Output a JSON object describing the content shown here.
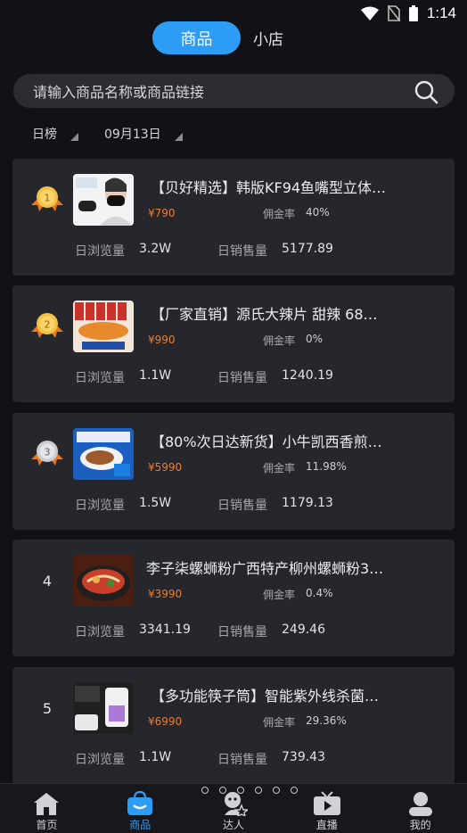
{
  "status_bar": {
    "time": "1:14"
  },
  "top_tabs": {
    "active": "商品",
    "other": "小店"
  },
  "search": {
    "placeholder": "请输入商品名称或商品链接"
  },
  "filters": {
    "period": "日榜",
    "date": "09月13日"
  },
  "list_labels": {
    "rate": "佣金率",
    "views": "日浏览量",
    "sales": "日销售量"
  },
  "products": [
    {
      "rank": "1",
      "title": "【贝好精选】韩版KF94鱼嘴型立体…",
      "price": "¥790",
      "rate": "40%",
      "views": "3.2W",
      "sales": "5177.89",
      "medal": "gold"
    },
    {
      "rank": "2",
      "title": "【厂家直销】源氏大辣片 甜辣 68…",
      "price": "¥990",
      "rate": "0%",
      "views": "1.1W",
      "sales": "1240.19",
      "medal": "gold"
    },
    {
      "rank": "3",
      "title": "【80%次日达新货】小牛凯西香煎…",
      "price": "¥5990",
      "rate": "11.98%",
      "views": "1.5W",
      "sales": "1179.13",
      "medal": "silver"
    },
    {
      "rank": "4",
      "title": "李子柒螺蛳粉广西特产柳州螺蛳粉3…",
      "price": "¥3990",
      "rate": "0.4%",
      "views": "3341.19",
      "sales": "249.46",
      "medal": "none"
    },
    {
      "rank": "5",
      "title": "【多功能筷子筒】智能紫外线杀菌…",
      "price": "¥6990",
      "rate": "29.36%",
      "views": "1.1W",
      "sales": "739.43",
      "medal": "none"
    }
  ],
  "bottom_nav": [
    {
      "label": "首页",
      "icon": "home-icon"
    },
    {
      "label": "商品",
      "icon": "shopping-bag-icon"
    },
    {
      "label": "达人",
      "icon": "talent-icon"
    },
    {
      "label": "直播",
      "icon": "live-tv-icon"
    },
    {
      "label": "我的",
      "icon": "profile-icon"
    }
  ],
  "colors": {
    "accent": "#2d9cf5",
    "price": "#f07c2c",
    "background": "#121216",
    "card": "#26262d"
  }
}
